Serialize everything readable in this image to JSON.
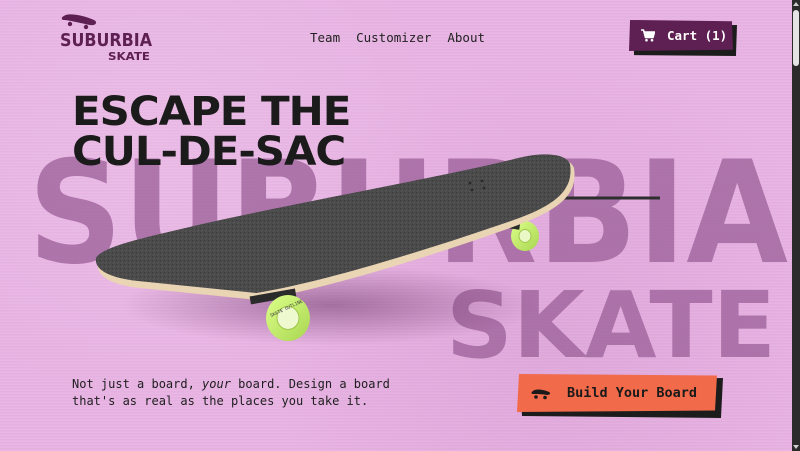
{
  "brand": {
    "logo_line1": "SUBURBIA",
    "logo_line2": "SKATE",
    "background_wordmark_line1": "SUBURBIA",
    "background_wordmark_line2": "SKATE"
  },
  "nav": {
    "items": [
      {
        "label": "Team"
      },
      {
        "label": "Customizer"
      },
      {
        "label": "About"
      }
    ]
  },
  "cart": {
    "label": "Cart (1)",
    "icon": "cart-icon"
  },
  "hero": {
    "title_line1": "ESCAPE THE",
    "title_line2": "CUL-DE-SAC",
    "tagline_before": "Not just a board, ",
    "tagline_emphasis": "your",
    "tagline_after": " board. Design a board that's as real as the places you take it.",
    "cta_label": "Build Your Board",
    "cta_icon": "skateboard-icon",
    "wheel_text": "SKATE OUTLINE"
  },
  "colors": {
    "background": "#e9b4e4",
    "brand_purple": "#5e1f52",
    "cta_orange": "#f16a4a",
    "wordmark_purple": "#9a5f98",
    "wheel_green": "#c8f06e",
    "text_dark": "#1b1b1b"
  }
}
